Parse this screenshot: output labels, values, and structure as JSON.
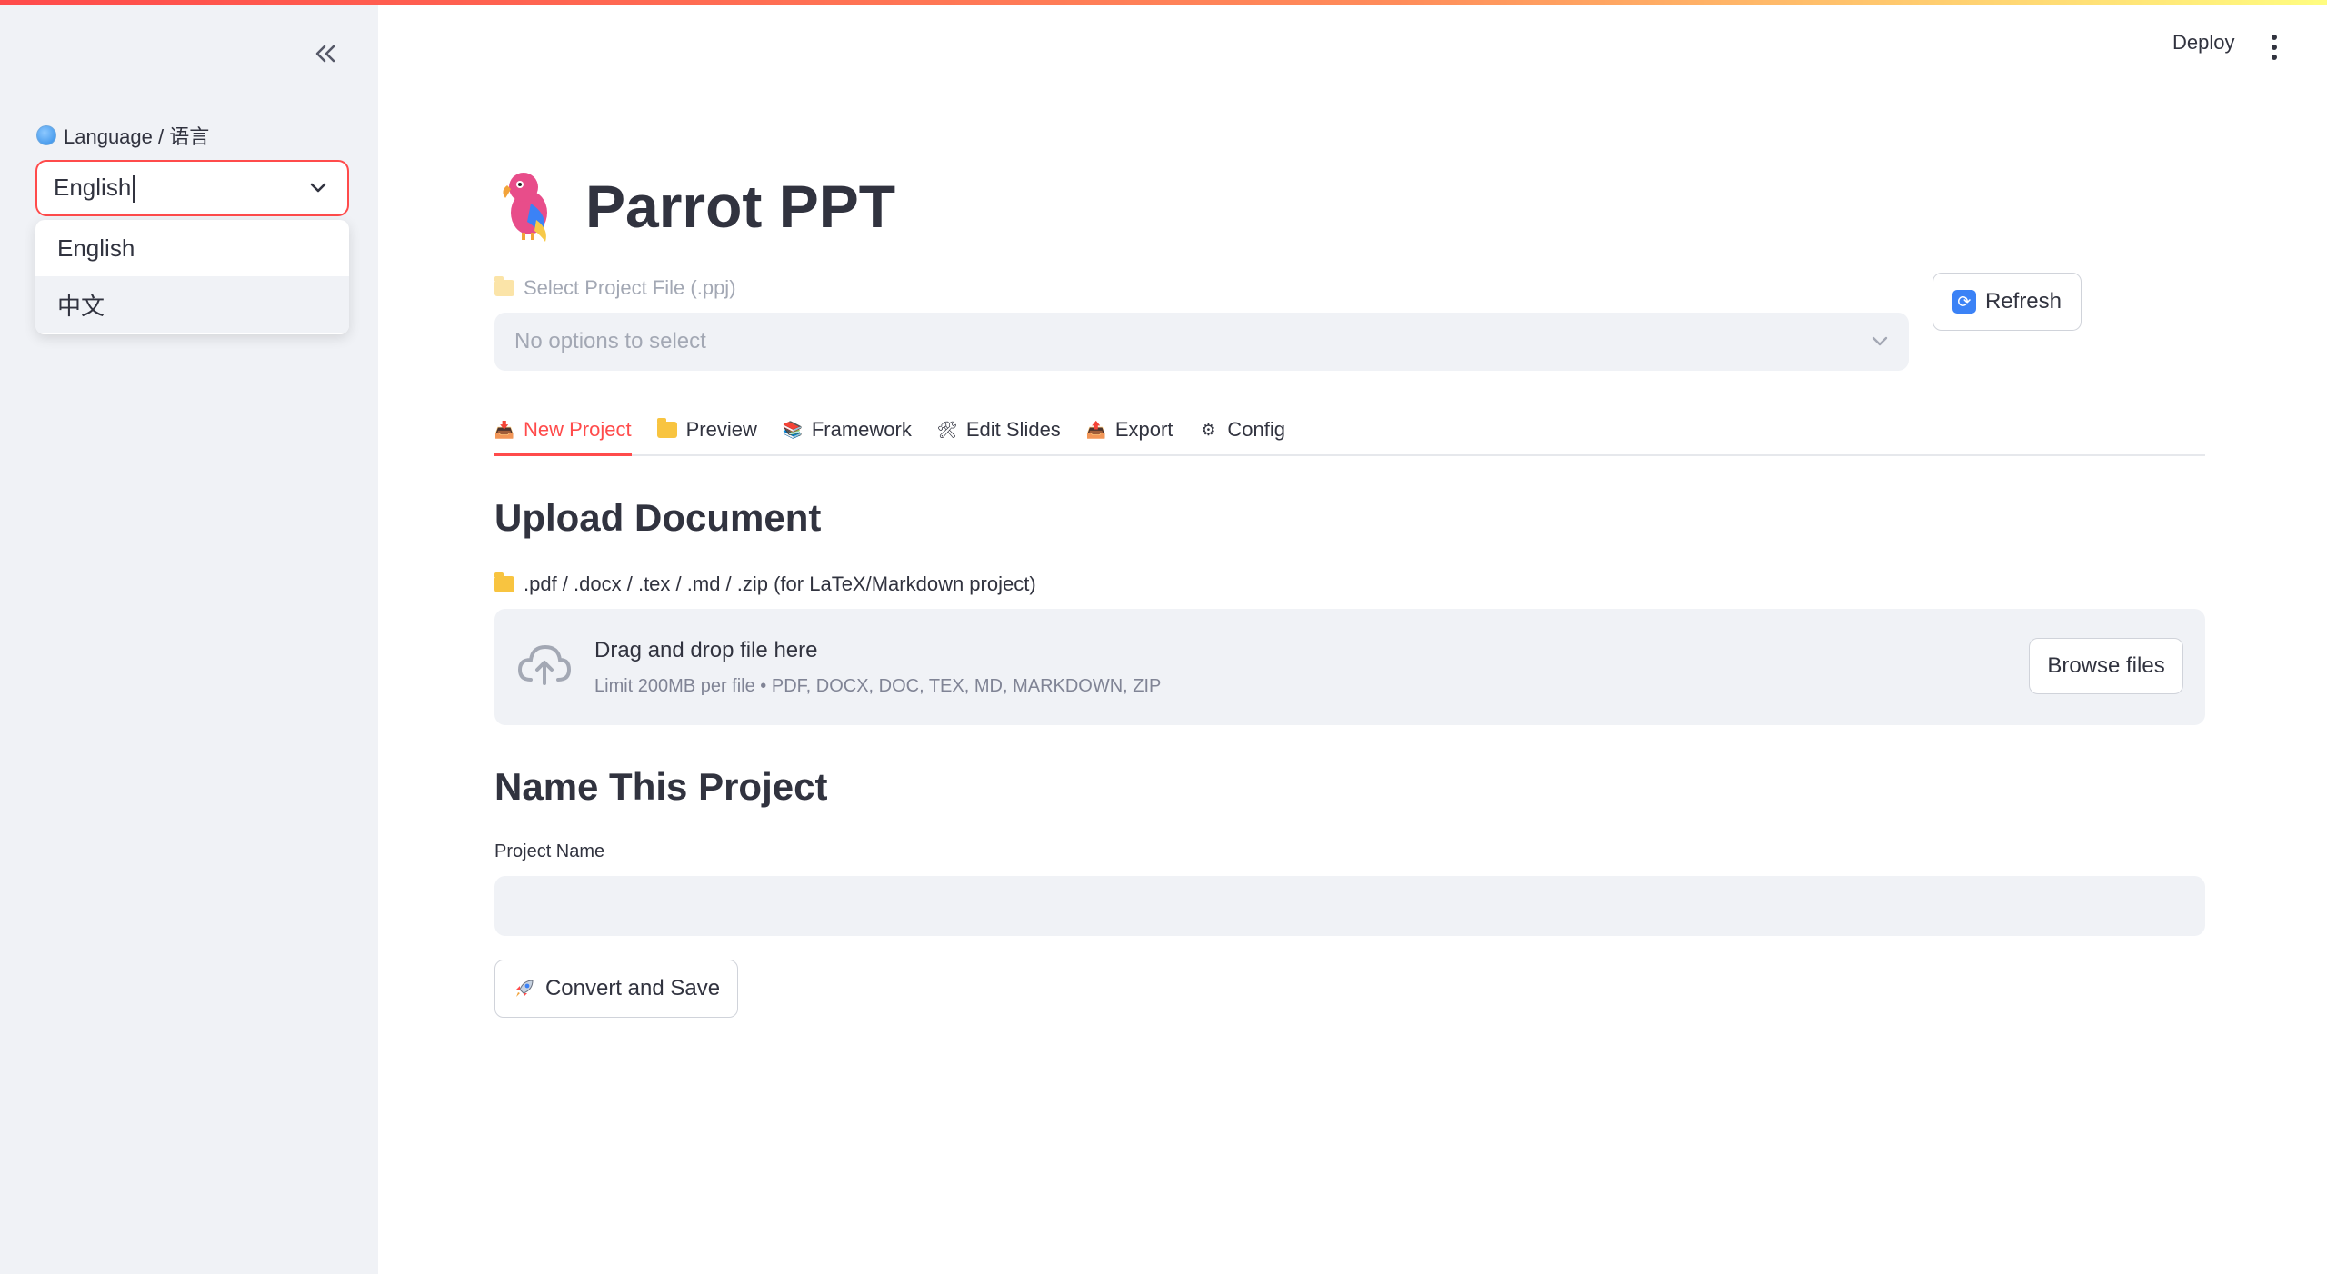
{
  "sidebar": {
    "collapse_icon": "double-chevron-left-icon",
    "language_label": "Language / 语言",
    "language_value": "English",
    "language_options": [
      "English",
      "中文"
    ],
    "highlighted_option": "中文"
  },
  "header": {
    "deploy_label": "Deploy",
    "menu_icon": "kebab-menu-icon"
  },
  "main": {
    "title": "Parrot PPT",
    "project_select_label": "Select Project File (.ppj)",
    "project_select_placeholder": "No options to select",
    "refresh_label": "Refresh",
    "tabs": [
      {
        "label": "New Project",
        "icon": "inbox-tray-icon",
        "active": true
      },
      {
        "label": "Preview",
        "icon": "folder-icon",
        "active": false
      },
      {
        "label": "Framework",
        "icon": "books-icon",
        "active": false
      },
      {
        "label": "Edit Slides",
        "icon": "hammer-wrench-icon",
        "active": false
      },
      {
        "label": "Export",
        "icon": "outbox-tray-icon",
        "active": false
      },
      {
        "label": "Config",
        "icon": "gear-icon",
        "active": false
      }
    ],
    "upload_heading": "Upload Document",
    "upload_hint": ".pdf / .docx / .tex / .md / .zip (for LaTeX/Markdown project)",
    "dropzone_title": "Drag and drop file here",
    "dropzone_limit": "Limit 200MB per file • PDF, DOCX, DOC, TEX, MD, MARKDOWN, ZIP",
    "browse_label": "Browse files",
    "name_heading": "Name This Project",
    "project_name_label": "Project Name",
    "project_name_value": "",
    "convert_label": "Convert and Save"
  },
  "colors": {
    "accent": "#ff4b4b",
    "sidebar_bg": "#f0f2f6",
    "text": "#31333f"
  }
}
